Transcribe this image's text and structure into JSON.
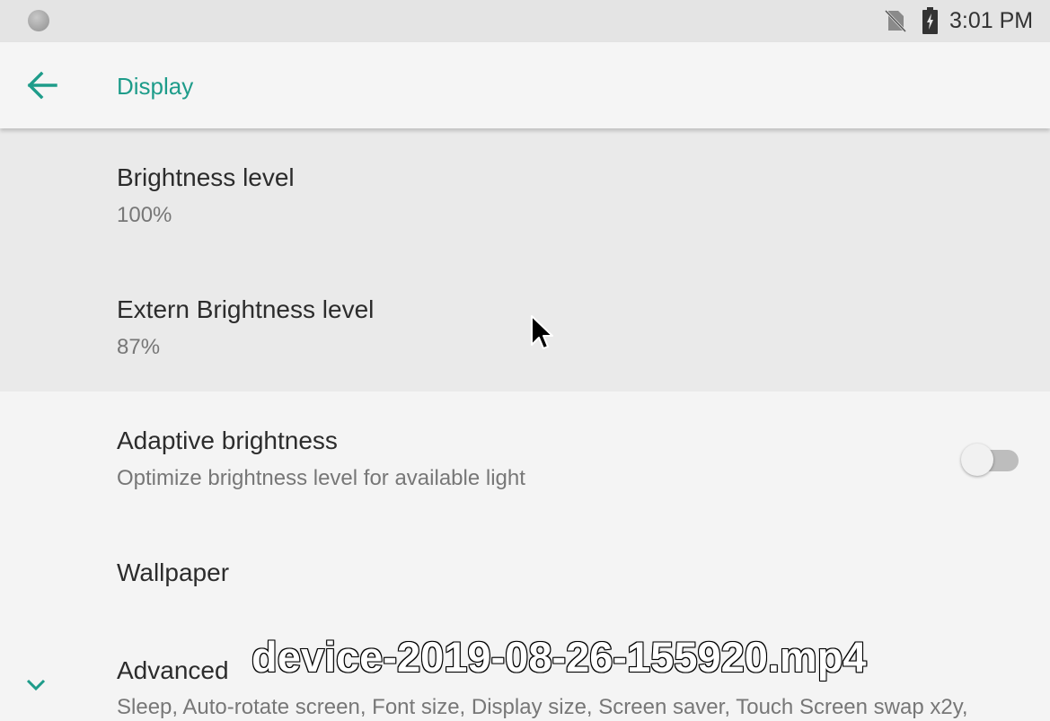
{
  "status_bar": {
    "time": "3:01 PM",
    "icons": [
      "notification-dot-icon",
      "no-sim-icon",
      "battery-charging-icon"
    ]
  },
  "app_bar": {
    "back_icon": "arrow-left-icon",
    "title": "Display"
  },
  "preferences": [
    {
      "title": "Brightness level",
      "summary": "100%"
    },
    {
      "title": "Extern Brightness level",
      "summary": "87%"
    },
    {
      "title": "Adaptive brightness",
      "summary": "Optimize brightness level for available light",
      "toggle_on": false
    },
    {
      "title": "Wallpaper"
    },
    {
      "title": "Advanced",
      "summary": "Sleep, Auto-rotate screen, Font size, Display size, Screen saver, Touch Screen swap x2y,",
      "icon": "chevron-down-icon"
    }
  ],
  "overlay": {
    "watermark": "device-2019-08-26-155920.mp4"
  },
  "colors": {
    "accent": "#1e9c8a",
    "status_bar_bg": "#e4e4e4",
    "background": "#f4f4f4",
    "highlight_bg": "#eaeaea"
  }
}
